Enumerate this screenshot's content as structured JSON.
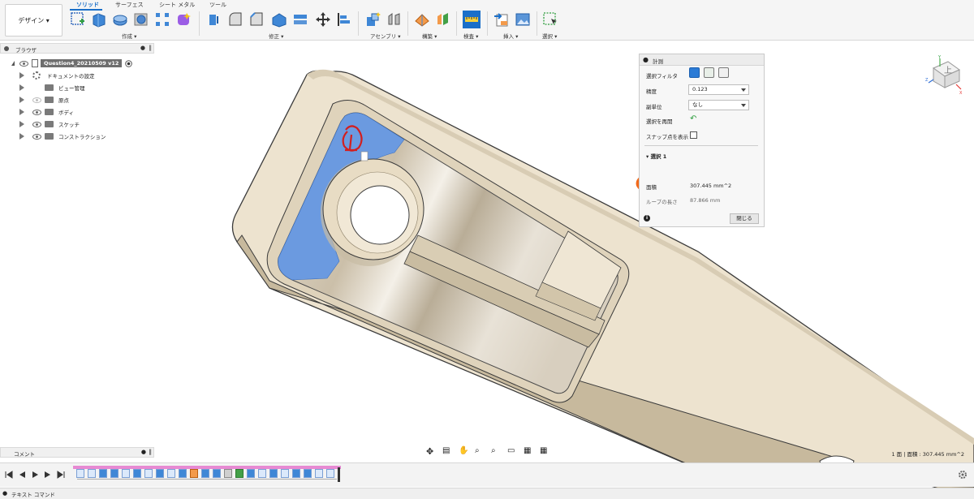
{
  "toolbar": {
    "workspace": "デザイン ▾",
    "tabs": [
      "ソリッド",
      "サーフェス",
      "シート メタル",
      "ツール"
    ],
    "groups": [
      "作成 ▾",
      "修正 ▾",
      "アセンブリ ▾",
      "構築 ▾",
      "検査 ▾",
      "挿入 ▾",
      "選択 ▾"
    ]
  },
  "browser": {
    "title": "ブラウザ",
    "root": "Question4_20210509 v12",
    "items": [
      "ドキュメントの設定",
      "ビュー管理",
      "原点",
      "ボディ",
      "スケッチ",
      "コンストラクション"
    ]
  },
  "comments": {
    "label": "コメント"
  },
  "measure": {
    "title": "計測",
    "filter_label": "選択フィルタ",
    "precision_label": "精度",
    "precision_value": "0.123",
    "subunit_label": "副単位",
    "subunit_value": "なし",
    "restart_label": "選択を再開",
    "snap_label": "スナップ点を表示",
    "section": "選択 1",
    "area_label": "面積",
    "area_value": "307.445 mm^2",
    "loop_label": "ループの長さ",
    "loop_value": "87.866 mm",
    "close": "閉じる"
  },
  "viewcube": {
    "face": "上",
    "axes": [
      "Z",
      "X",
      "Y"
    ]
  },
  "status": {
    "selection": "1 面 | 面積 : 307.445 mm^2"
  },
  "textcommand": {
    "label": "テキスト コマンド"
  },
  "annotations": {
    "circle_color": "#f26a1b",
    "mark_color": "#d21f1f"
  },
  "selection_color": "#6b9ae0"
}
